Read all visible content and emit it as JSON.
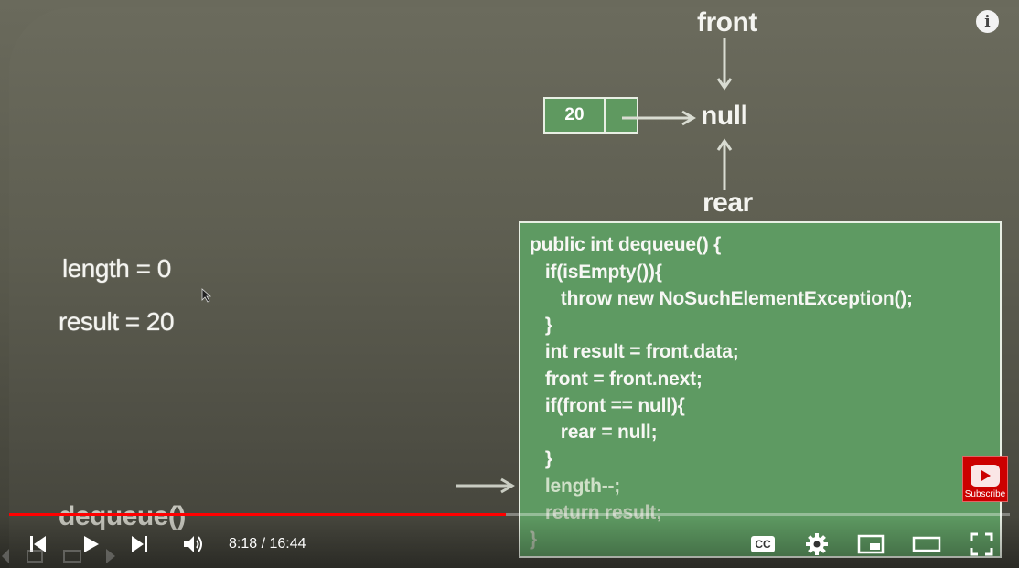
{
  "slide": {
    "front_label": "front",
    "rear_label": "rear",
    "null_label": "null",
    "node_value": "20",
    "length_text": "length = 0",
    "result_text": "result = 20",
    "method_title": "dequeue()",
    "code_lines": [
      "public int dequeue() {",
      "   if(isEmpty()){",
      "      throw new NoSuchElementException();",
      "   }",
      "   int result = front.data;",
      "   front = front.next;",
      "   if(front == null){",
      "      rear = null;",
      "   }",
      "   length--;",
      "   return result;",
      "}"
    ]
  },
  "player": {
    "current_time": "8:18",
    "duration": "16:44",
    "time_display": "8:18 / 16:44",
    "progress_fraction": 0.496,
    "subscribe_label": "Subscribe",
    "cc_label": "CC",
    "info_label": "i",
    "colors": {
      "progress": "#ff0000",
      "code_bg": "#5e9a62",
      "subscribe_bg": "#cc0000"
    }
  }
}
